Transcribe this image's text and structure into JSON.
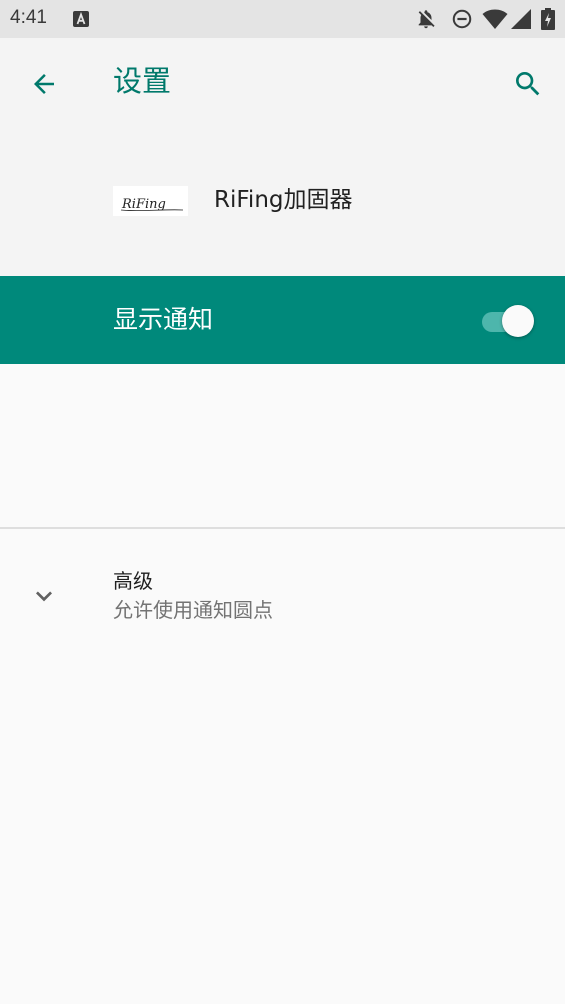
{
  "status_bar": {
    "time": "4:41",
    "icons": [
      "app-a-icon",
      "notifications-off-icon",
      "do-not-disturb-icon",
      "wifi-icon",
      "cell-signal-icon",
      "battery-charging-icon"
    ]
  },
  "app_bar": {
    "title": "设置",
    "back_icon": "arrow-back-icon",
    "search_icon": "search-icon"
  },
  "app_header": {
    "app_name": "RiFing加固器",
    "logo_text": "RiFing"
  },
  "master_switch": {
    "label": "显示通知",
    "checked": true
  },
  "advanced": {
    "title": "高级",
    "summary": "允许使用通知圆点",
    "icon": "chevron-down-icon"
  },
  "colors": {
    "accent": "#00796b",
    "switch_bar": "#00897b",
    "switch_track": "#4db6ac",
    "background": "#fafafa",
    "header_bg": "#f4f4f4",
    "status_bar_bg": "#e4e4e4"
  }
}
